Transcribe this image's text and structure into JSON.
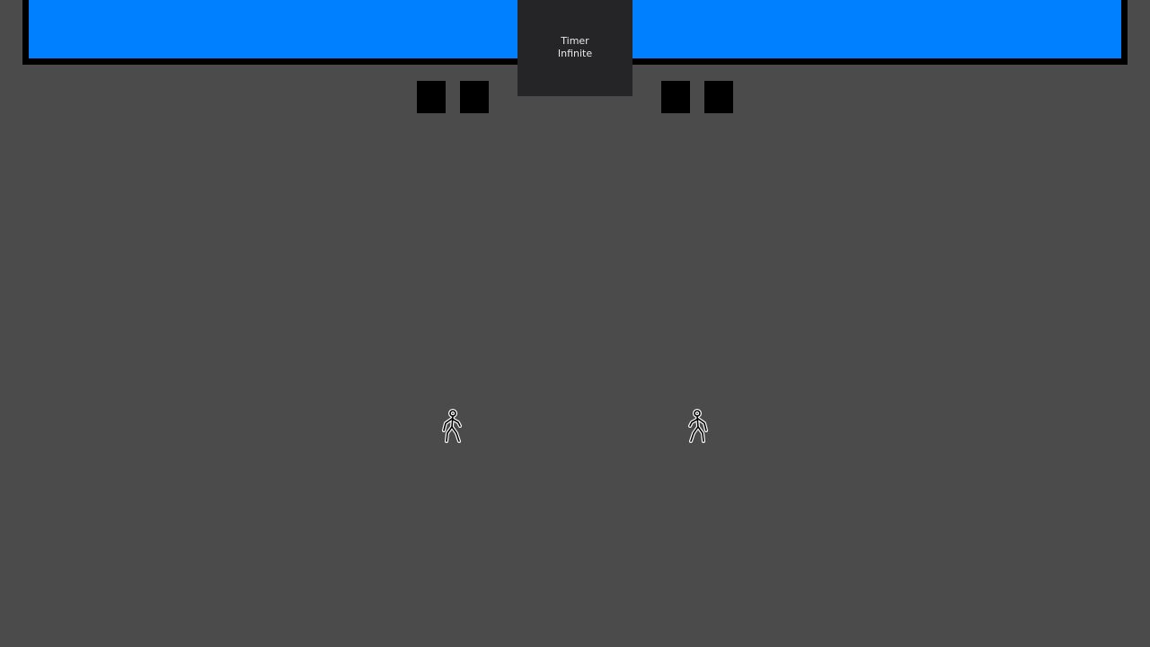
{
  "hud": {
    "health_bar_color": "#0080ff",
    "health_bar_level": 1.0,
    "timer": {
      "label": "Timer",
      "value": "Infinite"
    },
    "player1_slots": [
      "empty",
      "empty"
    ],
    "player2_slots": [
      "empty",
      "empty"
    ]
  },
  "arena": {
    "background_color": "#4b4b4b",
    "fighters": [
      {
        "icon": "stick-figure-fighter-icon",
        "facing": "left"
      },
      {
        "icon": "stick-figure-fighter-icon",
        "facing": "right"
      }
    ]
  }
}
